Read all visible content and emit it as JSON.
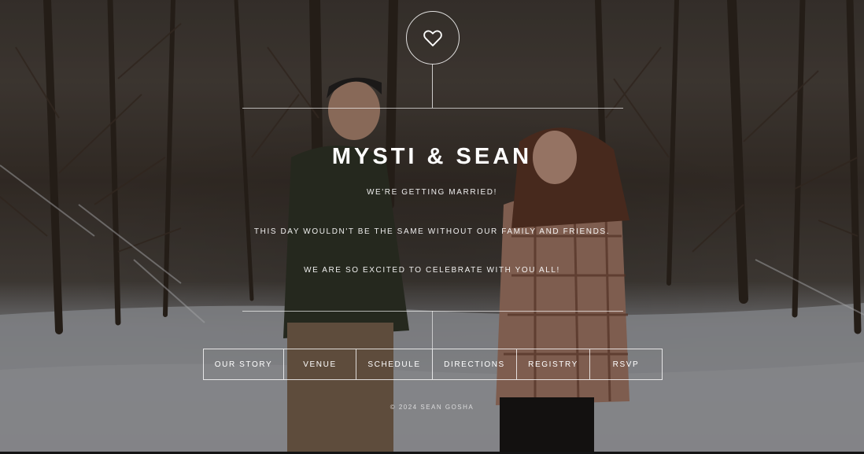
{
  "hero": {
    "background": "winter-forest-couple-photo",
    "couple_names": "MYSTI & SEAN",
    "subtitle": "WE'RE GETTING MARRIED!",
    "message_line1": "THIS DAY WOULDN'T BE THE SAME WITHOUT OUR FAMILY AND FRIENDS.",
    "message_line2": "WE ARE SO EXCITED TO CELEBRATE WITH YOU ALL!"
  },
  "icon": "heart-outline-icon",
  "nav": {
    "items": [
      {
        "label": "OUR STORY"
      },
      {
        "label": "VENUE"
      },
      {
        "label": "SCHEDULE"
      },
      {
        "label": "DIRECTIONS"
      },
      {
        "label": "REGISTRY"
      },
      {
        "label": "RSVP"
      }
    ]
  },
  "footer": {
    "copyright": "© 2024 SEAN GOSHA"
  },
  "colors": {
    "text": "#ffffff",
    "lines": "#ffffff"
  }
}
